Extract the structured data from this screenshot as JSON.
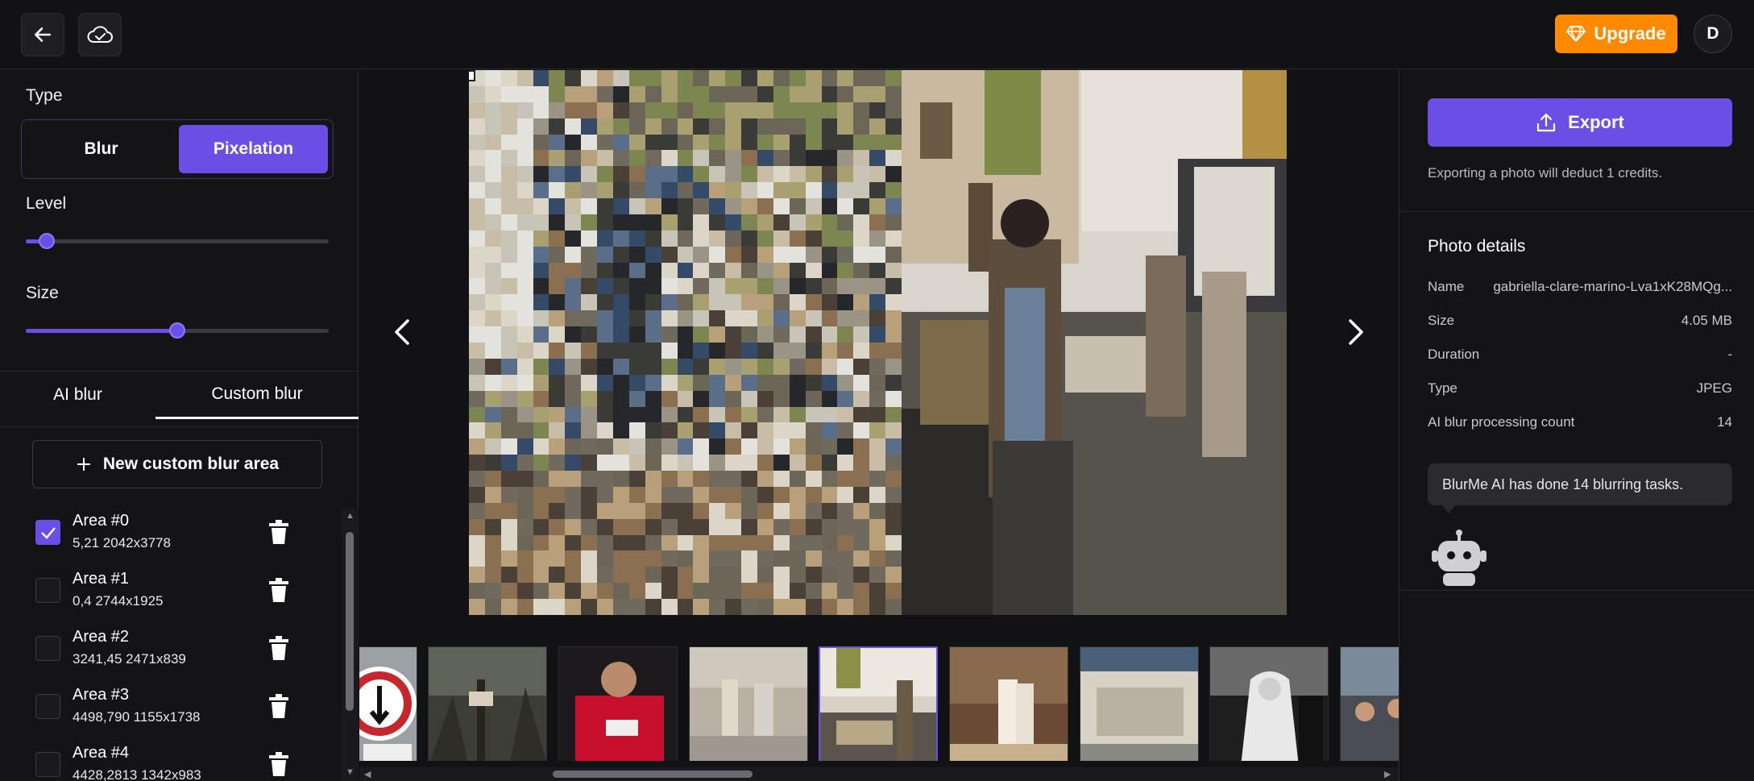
{
  "header": {
    "back_icon": "arrow-left-icon",
    "cloud_icon": "cloud-check-icon",
    "upgrade_label": "Upgrade",
    "avatar_initial": "D",
    "accent": "#ff8a00"
  },
  "left": {
    "type_label": "Type",
    "type_options": [
      "Blur",
      "Pixelation"
    ],
    "type_selected": "Pixelation",
    "level_label": "Level",
    "level_value": 0.07,
    "size_label": "Size",
    "size_value": 0.5,
    "tabs": [
      "AI blur",
      "Custom blur"
    ],
    "tab_selected": "Custom blur",
    "new_area_label": "New custom blur area",
    "areas": [
      {
        "name": "Area #0",
        "meta": "5,21 2042x3778",
        "checked": true
      },
      {
        "name": "Area #1",
        "meta": "0,4 2744x1925",
        "checked": false
      },
      {
        "name": "Area #2",
        "meta": "3241,45 2471x839",
        "checked": false
      },
      {
        "name": "Area #3",
        "meta": "4498,790 1155x1738",
        "checked": false
      },
      {
        "name": "Area #4",
        "meta": "4428,2813 1342x983",
        "checked": false
      }
    ],
    "accent": "#6b4ee6"
  },
  "right": {
    "export_label": "Export",
    "export_note": "Exporting a photo will deduct 1 credits.",
    "details_title": "Photo details",
    "details": [
      {
        "key": "Name",
        "value": "gabriella-clare-marino-Lva1xK28MQg..."
      },
      {
        "key": "Size",
        "value": "4.05 MB"
      },
      {
        "key": "Duration",
        "value": "-"
      },
      {
        "key": "Type",
        "value": "JPEG"
      },
      {
        "key": "AI blur processing count",
        "value": "14"
      }
    ],
    "tooltip": "BlurMe AI has done 14 blurring tasks."
  }
}
